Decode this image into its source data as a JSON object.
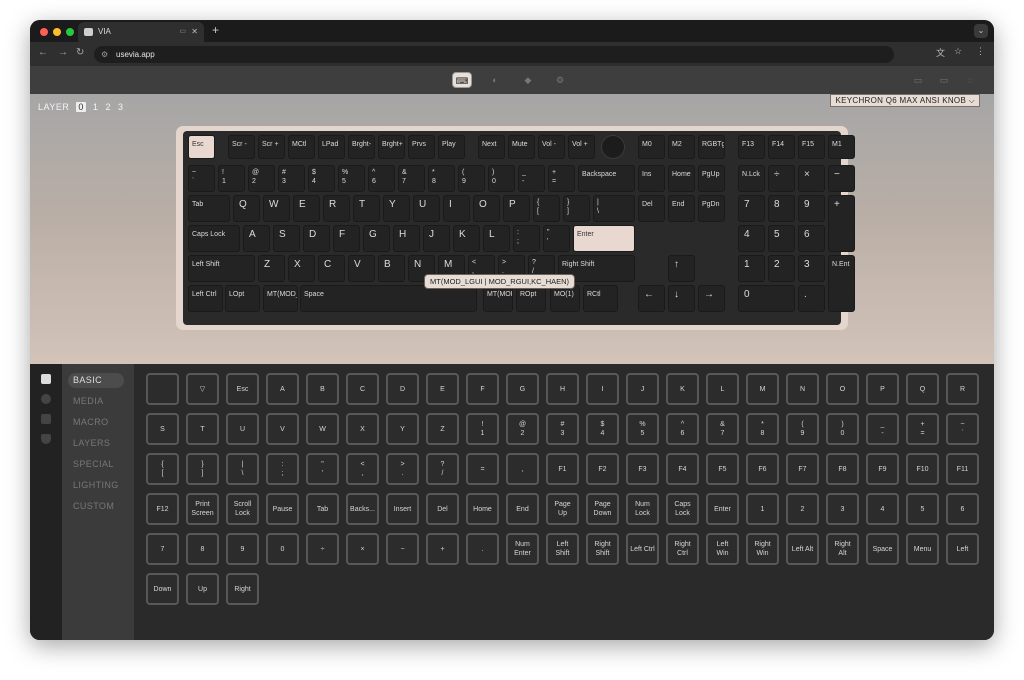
{
  "browser": {
    "tab_title": "VIA",
    "url": "usevia.app"
  },
  "via": {
    "layer_label": "LAYER",
    "layers": [
      "0",
      "1",
      "2",
      "3"
    ],
    "active_layer": "0",
    "keyboard_name": "KEYCHRON Q6 MAX ANSI KNOB"
  },
  "tooltip": "MT(MOD_LGUI | MOD_RGUI,KC_HAEN)",
  "categories": [
    "BASIC",
    "MEDIA",
    "MACRO",
    "LAYERS",
    "SPECIAL",
    "LIGHTING",
    "CUSTOM"
  ],
  "active_category": "BASIC",
  "keymap": [
    [
      0,
      0,
      2.7,
      2.4,
      "Esc",
      1
    ],
    [
      4,
      0,
      2.7,
      2.4,
      "Scr -"
    ],
    [
      7,
      0,
      2.7,
      2.4,
      "Scr +"
    ],
    [
      10,
      0,
      2.7,
      2.4,
      "MCtl"
    ],
    [
      13,
      0,
      2.7,
      2.4,
      "LPad"
    ],
    [
      16,
      0,
      2.7,
      2.4,
      "Brght-"
    ],
    [
      19,
      0,
      2.7,
      2.4,
      "Brght+"
    ],
    [
      22,
      0,
      2.7,
      2.4,
      "Prvs"
    ],
    [
      25,
      0,
      2.7,
      2.4,
      "Play"
    ],
    [
      29,
      0,
      2.7,
      2.4,
      "Next"
    ],
    [
      32,
      0,
      2.7,
      2.4,
      "Mute"
    ],
    [
      35,
      0,
      2.7,
      2.4,
      "Vol -"
    ],
    [
      38,
      0,
      2.7,
      2.4,
      "Vol +"
    ],
    [
      41.3,
      0,
      2.4,
      2.4,
      "",
      2
    ],
    [
      45,
      0,
      2.7,
      2.4,
      "M0"
    ],
    [
      48,
      0,
      2.7,
      2.4,
      "M2"
    ],
    [
      51,
      0,
      2.7,
      2.4,
      "RGBTg"
    ],
    [
      55,
      0,
      2.7,
      2.4,
      "F13"
    ],
    [
      58,
      0,
      2.7,
      2.4,
      "F14"
    ],
    [
      61,
      0,
      2.7,
      2.4,
      "F15"
    ],
    [
      64,
      0,
      2.7,
      2.4,
      "M1"
    ],
    [
      0,
      3,
      2.7,
      2.7,
      "~\n`"
    ],
    [
      3,
      3,
      2.7,
      2.7,
      "!\n1"
    ],
    [
      6,
      3,
      2.7,
      2.7,
      "@\n2"
    ],
    [
      9,
      3,
      2.7,
      2.7,
      "#\n3"
    ],
    [
      12,
      3,
      2.7,
      2.7,
      "$\n4"
    ],
    [
      15,
      3,
      2.7,
      2.7,
      "%\n5"
    ],
    [
      18,
      3,
      2.7,
      2.7,
      "^\n6"
    ],
    [
      21,
      3,
      2.7,
      2.7,
      "&\n7"
    ],
    [
      24,
      3,
      2.7,
      2.7,
      "*\n8"
    ],
    [
      27,
      3,
      2.7,
      2.7,
      "(\n9"
    ],
    [
      30,
      3,
      2.7,
      2.7,
      ")\n0"
    ],
    [
      33,
      3,
      2.7,
      2.7,
      "_\n-"
    ],
    [
      36,
      3,
      2.7,
      2.7,
      "+\n="
    ],
    [
      39,
      3,
      5.7,
      2.7,
      "Backspace"
    ],
    [
      45,
      3,
      2.7,
      2.7,
      "Ins"
    ],
    [
      48,
      3,
      2.7,
      2.7,
      "Home"
    ],
    [
      51,
      3,
      2.7,
      2.7,
      "PgUp"
    ],
    [
      55,
      3,
      2.7,
      2.7,
      "N.Lck"
    ],
    [
      58,
      3,
      2.7,
      2.7,
      "÷",
      3
    ],
    [
      61,
      3,
      2.7,
      2.7,
      "×",
      3
    ],
    [
      64,
      3,
      2.7,
      2.7,
      "−",
      3
    ],
    [
      0,
      6,
      4.2,
      2.7,
      "Tab"
    ],
    [
      4.5,
      6,
      2.7,
      2.7,
      "Q",
      3
    ],
    [
      7.5,
      6,
      2.7,
      2.7,
      "W",
      3
    ],
    [
      10.5,
      6,
      2.7,
      2.7,
      "E",
      3
    ],
    [
      13.5,
      6,
      2.7,
      2.7,
      "R",
      3
    ],
    [
      16.5,
      6,
      2.7,
      2.7,
      "T",
      3
    ],
    [
      19.5,
      6,
      2.7,
      2.7,
      "Y",
      3
    ],
    [
      22.5,
      6,
      2.7,
      2.7,
      "U",
      3
    ],
    [
      25.5,
      6,
      2.7,
      2.7,
      "I",
      3
    ],
    [
      28.5,
      6,
      2.7,
      2.7,
      "O",
      3
    ],
    [
      31.5,
      6,
      2.7,
      2.7,
      "P",
      3
    ],
    [
      34.5,
      6,
      2.7,
      2.7,
      "{\n["
    ],
    [
      37.5,
      6,
      2.7,
      2.7,
      "}\n]"
    ],
    [
      40.5,
      6,
      4.2,
      2.7,
      "|\n\\"
    ],
    [
      45,
      6,
      2.7,
      2.7,
      "Del"
    ],
    [
      48,
      6,
      2.7,
      2.7,
      "End"
    ],
    [
      51,
      6,
      2.7,
      2.7,
      "PgDn"
    ],
    [
      55,
      6,
      2.7,
      2.7,
      "7",
      3
    ],
    [
      58,
      6,
      2.7,
      2.7,
      "8",
      3
    ],
    [
      61,
      6,
      2.7,
      2.7,
      "9",
      3
    ],
    [
      64,
      6,
      2.7,
      5.7,
      "+",
      3
    ],
    [
      0,
      9,
      5.2,
      2.7,
      "Caps Lock"
    ],
    [
      5.5,
      9,
      2.7,
      2.7,
      "A",
      3
    ],
    [
      8.5,
      9,
      2.7,
      2.7,
      "S",
      3
    ],
    [
      11.5,
      9,
      2.7,
      2.7,
      "D",
      3
    ],
    [
      14.5,
      9,
      2.7,
      2.7,
      "F",
      3
    ],
    [
      17.5,
      9,
      2.7,
      2.7,
      "G",
      3
    ],
    [
      20.5,
      9,
      2.7,
      2.7,
      "H",
      3
    ],
    [
      23.5,
      9,
      2.7,
      2.7,
      "J",
      3
    ],
    [
      26.5,
      9,
      2.7,
      2.7,
      "K",
      3
    ],
    [
      29.5,
      9,
      2.7,
      2.7,
      "L",
      3
    ],
    [
      32.5,
      9,
      2.7,
      2.7,
      ":\n;"
    ],
    [
      35.5,
      9,
      2.7,
      2.7,
      "\"\n'"
    ],
    [
      38.5,
      9,
      6.2,
      2.7,
      "Enter",
      1
    ],
    [
      55,
      9,
      2.7,
      2.7,
      "4",
      3
    ],
    [
      58,
      9,
      2.7,
      2.7,
      "5",
      3
    ],
    [
      61,
      9,
      2.7,
      2.7,
      "6",
      3
    ],
    [
      0,
      12,
      6.7,
      2.7,
      "Left Shift"
    ],
    [
      7,
      12,
      2.7,
      2.7,
      "Z",
      3
    ],
    [
      10,
      12,
      2.7,
      2.7,
      "X",
      3
    ],
    [
      13,
      12,
      2.7,
      2.7,
      "C",
      3
    ],
    [
      16,
      12,
      2.7,
      2.7,
      "V",
      3
    ],
    [
      19,
      12,
      2.7,
      2.7,
      "B",
      3
    ],
    [
      22,
      12,
      2.7,
      2.7,
      "N",
      3
    ],
    [
      25,
      12,
      2.7,
      2.7,
      "M",
      3
    ],
    [
      28,
      12,
      2.7,
      2.7,
      "<\n,"
    ],
    [
      31,
      12,
      2.7,
      2.7,
      ">\n."
    ],
    [
      34,
      12,
      2.7,
      2.7,
      "?\n/"
    ],
    [
      37,
      12,
      7.7,
      2.7,
      "Right Shift"
    ],
    [
      48,
      12,
      2.7,
      2.7,
      "↑",
      3
    ],
    [
      55,
      12,
      2.7,
      2.7,
      "1",
      3
    ],
    [
      58,
      12,
      2.7,
      2.7,
      "2",
      3
    ],
    [
      61,
      12,
      2.7,
      2.7,
      "3",
      3
    ],
    [
      64,
      12,
      2.7,
      5.7,
      "N.Ent"
    ],
    [
      0,
      15,
      3.5,
      2.7,
      "Left Ctrl"
    ],
    [
      3.7,
      15,
      3.5,
      2.7,
      "LOpt"
    ],
    [
      7.5,
      15,
      3.5,
      2.7,
      "MT(MOD_"
    ],
    [
      11.2,
      15,
      17.7,
      2.7,
      "Space"
    ],
    [
      29.5,
      15,
      3,
      2.7,
      "MT(MOD"
    ],
    [
      32.8,
      15,
      3,
      2.7,
      "ROpt"
    ],
    [
      36.2,
      15,
      3,
      2.7,
      "MO(1)"
    ],
    [
      39.5,
      15,
      3.5,
      2.7,
      "RCtl"
    ],
    [
      45,
      15,
      2.7,
      2.7,
      "←",
      3
    ],
    [
      48,
      15,
      2.7,
      2.7,
      "↓",
      3
    ],
    [
      51,
      15,
      2.7,
      2.7,
      "→",
      3
    ],
    [
      55,
      15,
      5.7,
      2.7,
      "0",
      3
    ],
    [
      61,
      15,
      2.7,
      2.7,
      ".",
      3
    ]
  ],
  "basic_keys": [
    "",
    "▽",
    "Esc",
    "A",
    "B",
    "C",
    "D",
    "E",
    "F",
    "G",
    "H",
    "I",
    "J",
    "K",
    "L",
    "M",
    "N",
    "O",
    "P",
    "Q",
    "R",
    "S",
    "T",
    "U",
    "V",
    "W",
    "X",
    "Y",
    "Z",
    "!\n1",
    "@\n2",
    "#\n3",
    "$\n4",
    "%\n5",
    "^\n6",
    "&\n7",
    "*\n8",
    "(\n9",
    ")\n0",
    "_\n-",
    "+\n=",
    "~\n`",
    "{\n[",
    "}\n]",
    "|\n\\",
    ":\n;",
    "\"\n'",
    "<\n,",
    ">\n.",
    "?\n/",
    "=",
    ",",
    "F1",
    "F2",
    "F3",
    "F4",
    "F5",
    "F6",
    "F7",
    "F8",
    "F9",
    "F10",
    "F11",
    "F12",
    "Print\nScreen",
    "Scroll\nLock",
    "Pause",
    "Tab",
    "Backs...",
    "Insert",
    "Del",
    "Home",
    "End",
    "Page\nUp",
    "Page\nDown",
    "Num\nLock",
    "Caps\nLock",
    "Enter",
    "1",
    "2",
    "3",
    "4",
    "5",
    "6",
    "7",
    "8",
    "9",
    "0",
    "÷",
    "×",
    "−",
    "+",
    ".",
    "Num\nEnter",
    "Left\nShift",
    "Right\nShift",
    "Left Ctrl",
    "Right\nCtrl",
    "Left\nWin",
    "Right\nWin",
    "Left Alt",
    "Right\nAlt",
    "Space",
    "Menu",
    "Left",
    "Down",
    "Up",
    "Right"
  ]
}
